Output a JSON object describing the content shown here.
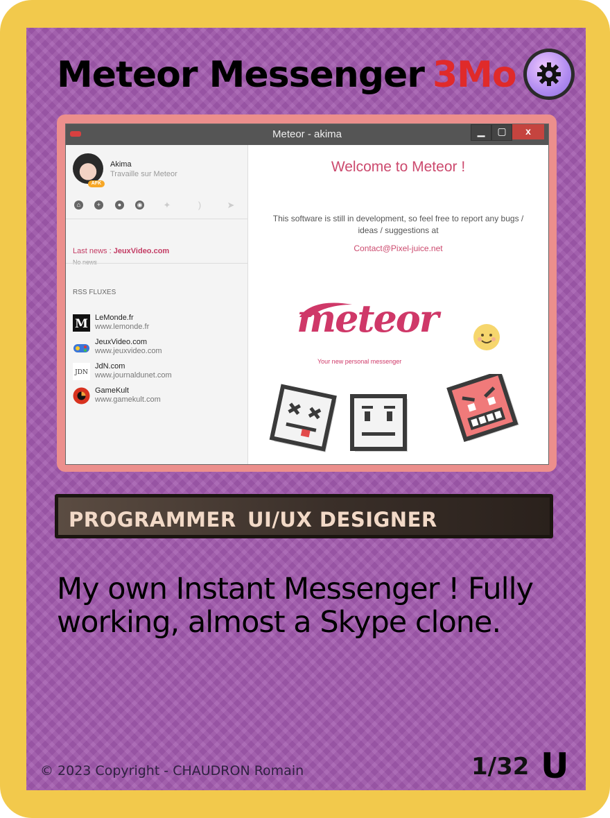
{
  "card": {
    "title": "Meteor Messenger",
    "cost": "3Mo",
    "type_icon": "gear-icon",
    "skills": [
      "PROGRAMMER",
      "UI/UX DESIGNER"
    ],
    "description": "My own Instant Messenger ! Fully working, almost a Skype clone.",
    "copyright": "© 2023 Copyright - CHAUDRON Romain",
    "number": "1/32",
    "rarity": "U",
    "colors": {
      "border": "#f2c94c",
      "background": "#a159ad",
      "cost": "#e02a2a"
    }
  },
  "app": {
    "window_title": "Meteor - akima",
    "window_controls": {
      "minimize": "▁",
      "maximize": "▢",
      "close": "x"
    },
    "user": {
      "name": "Akima",
      "status": "Travaille sur Meteor",
      "badge": "AFK"
    },
    "toolbar_icons": [
      "home-icon",
      "add-icon",
      "settings-icon",
      "contacts-icon",
      "run-icon",
      "rss-icon",
      "send-icon"
    ],
    "last_news_label": "Last news :",
    "last_news_source": "JeuxVideo.com",
    "last_news_value": "No news",
    "rss_title": "RSS FLUXES",
    "feeds": [
      {
        "name": "LeMonde.fr",
        "url": "www.lemonde.fr",
        "icon": "lemonde-logo"
      },
      {
        "name": "JeuxVideo.com",
        "url": "www.jeuxvideo.com",
        "icon": "jeuxvideo-logo"
      },
      {
        "name": "JdN.com",
        "url": "www.journaldunet.com",
        "icon": "jdn-logo"
      },
      {
        "name": "GameKult",
        "url": "www.gamekult.com",
        "icon": "gamekult-logo"
      }
    ],
    "welcome": "Welcome to Meteor !",
    "info": "This software is still in development, so feel free to report any bugs / ideas / suggestions at",
    "contact": "Contact@Pixel-juice.net",
    "logo_text": "meteor",
    "tagline": "Your new personal messenger",
    "accent": "#cc4a6e"
  }
}
